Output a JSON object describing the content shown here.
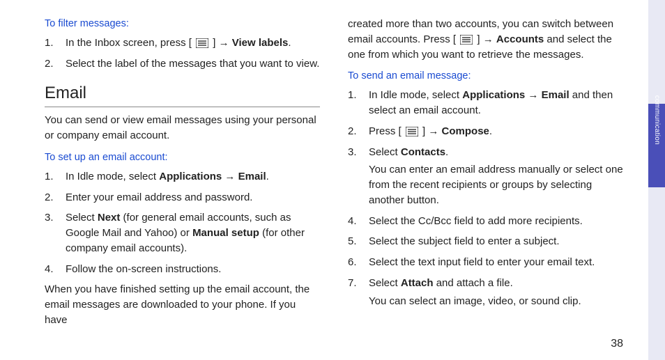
{
  "sideTab": {
    "label": "communication"
  },
  "pageNumber": "38",
  "left": {
    "filter": {
      "heading": "To filter messages:",
      "items": [
        {
          "pre": "In the Inbox screen, press [ ",
          "post": " ] → ",
          "bold": "View labels",
          "tail": "."
        },
        {
          "text": "Select the label of the messages that you want to view."
        }
      ]
    },
    "email": {
      "title": "Email",
      "intro": "You can send or view email messages using your personal or company email account.",
      "setup": {
        "heading": "To set up an email account:",
        "items": [
          {
            "pre": "In Idle mode, select ",
            "bold": "Applications",
            "arrow": " → ",
            "bold2": "Email",
            "tail": "."
          },
          {
            "text": "Enter your email address and password."
          },
          {
            "pre": "Select ",
            "bold": "Next",
            "mid": " (for general email accounts, such as Google Mail and Yahoo) or ",
            "bold2": "Manual setup",
            "tail": " (for other company email accounts)."
          },
          {
            "text": "Follow the on-screen instructions."
          }
        ],
        "after": "When you have finished setting up the email account, the email messages are downloaded to your phone. If you have"
      }
    }
  },
  "right": {
    "continuation": {
      "pre": "created more than two accounts, you can switch between email accounts. Press [ ",
      "post": " ] → ",
      "bold": "Accounts",
      "tail": " and select the one from which you want to retrieve the messages."
    },
    "send": {
      "heading": "To send an email message:",
      "items": [
        {
          "pre": "In Idle mode, select ",
          "bold": "Applications",
          "arrow": " → ",
          "bold2": "Email",
          "tail": " and then select an email account."
        },
        {
          "pre": "Press [ ",
          "icon": true,
          "post": " ] → ",
          "bold": "Compose",
          "tail": "."
        },
        {
          "pre": "Select ",
          "bold": "Contacts",
          "tail": ".",
          "sub": "You can enter an email address manually or select one from the recent recipients or groups by selecting another button."
        },
        {
          "text": "Select the Cc/Bcc field to add more recipients."
        },
        {
          "text": "Select the subject field to enter a subject."
        },
        {
          "text": "Select the text input field to enter your email text."
        },
        {
          "pre": "Select ",
          "bold": "Attach",
          "tail": " and attach a file.",
          "sub": "You can select an image, video, or sound clip."
        }
      ]
    }
  }
}
